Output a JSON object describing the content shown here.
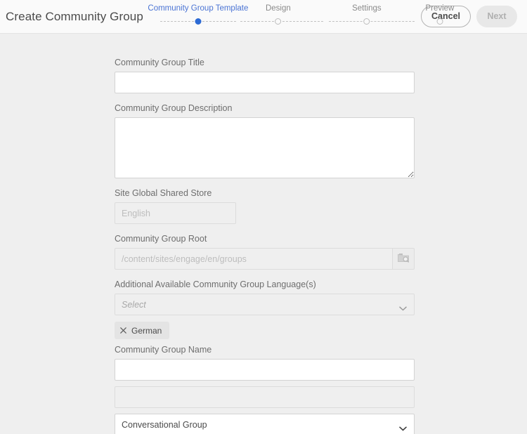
{
  "header": {
    "title": "Create Community Group",
    "steps": [
      {
        "label": "Community Group Template",
        "state": "active"
      },
      {
        "label": "Design",
        "state": "inactive"
      },
      {
        "label": "Settings",
        "state": "inactive"
      },
      {
        "label": "Preview",
        "state": "inactive"
      }
    ],
    "cancel_label": "Cancel",
    "next_label": "Next",
    "accent_color": "#2c6ad4",
    "active_label_color": "#4b74d4"
  },
  "form": {
    "title_field": {
      "label": "Community Group Title",
      "value": "",
      "placeholder": ""
    },
    "description_field": {
      "label": "Community Group Description",
      "value": "",
      "placeholder": ""
    },
    "shared_store_field": {
      "label": "Site Global Shared Store",
      "value": "",
      "placeholder": "English"
    },
    "root_field": {
      "label": "Community Group Root",
      "value": "",
      "placeholder": "/content/sites/engage/en/groups",
      "browse_icon": "folder-search-icon"
    },
    "languages_field": {
      "label": "Additional Available Community Group Language(s)",
      "placeholder": "Select",
      "chevron_icon": "chevron-down-icon",
      "tags": [
        {
          "label": "German",
          "remove_icon": "close-icon"
        }
      ]
    },
    "name_field": {
      "label": "Community Group Name",
      "value": "",
      "placeholder": ""
    },
    "secondary_name_field": {
      "label": "",
      "value": "",
      "placeholder": ""
    },
    "group_type_field": {
      "value": "Conversational Group",
      "chevron_icon": "chevron-down-icon"
    }
  }
}
